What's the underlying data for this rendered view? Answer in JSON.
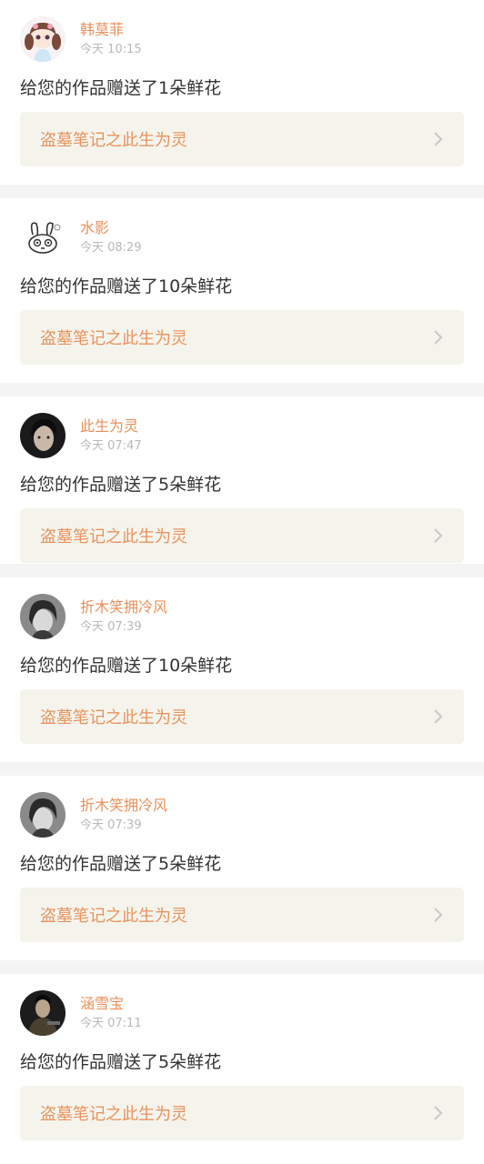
{
  "items": [
    {
      "name": "韩莫菲",
      "time": "今天 10:15",
      "message": "给您的作品赠送了1朵鲜花",
      "work": "盗墓笔记之此生为灵"
    },
    {
      "name": "水影",
      "time": "今天 08:29",
      "message": "给您的作品赠送了10朵鲜花",
      "work": "盗墓笔记之此生为灵"
    },
    {
      "name": "此生为灵",
      "time": "今天 07:47",
      "message": "给您的作品赠送了5朵鲜花",
      "work": "盗墓笔记之此生为灵"
    },
    {
      "name": "折木笑拥冷风",
      "time": "今天 07:39",
      "message": "给您的作品赠送了10朵鲜花",
      "work": "盗墓笔记之此生为灵"
    },
    {
      "name": "折木笑拥冷风",
      "time": "今天 07:39",
      "message": "给您的作品赠送了5朵鲜花",
      "work": "盗墓笔记之此生为灵"
    },
    {
      "name": "涵雪宝",
      "time": "今天 07:11",
      "message": "给您的作品赠送了5朵鲜花",
      "work": "盗墓笔记之此生为灵"
    }
  ],
  "colors": {
    "accent": "#e8905a",
    "work_bg": "#f5f4ec",
    "divider": "#f4f4f4"
  },
  "icons": {
    "chevron": "chevron-right-icon"
  }
}
